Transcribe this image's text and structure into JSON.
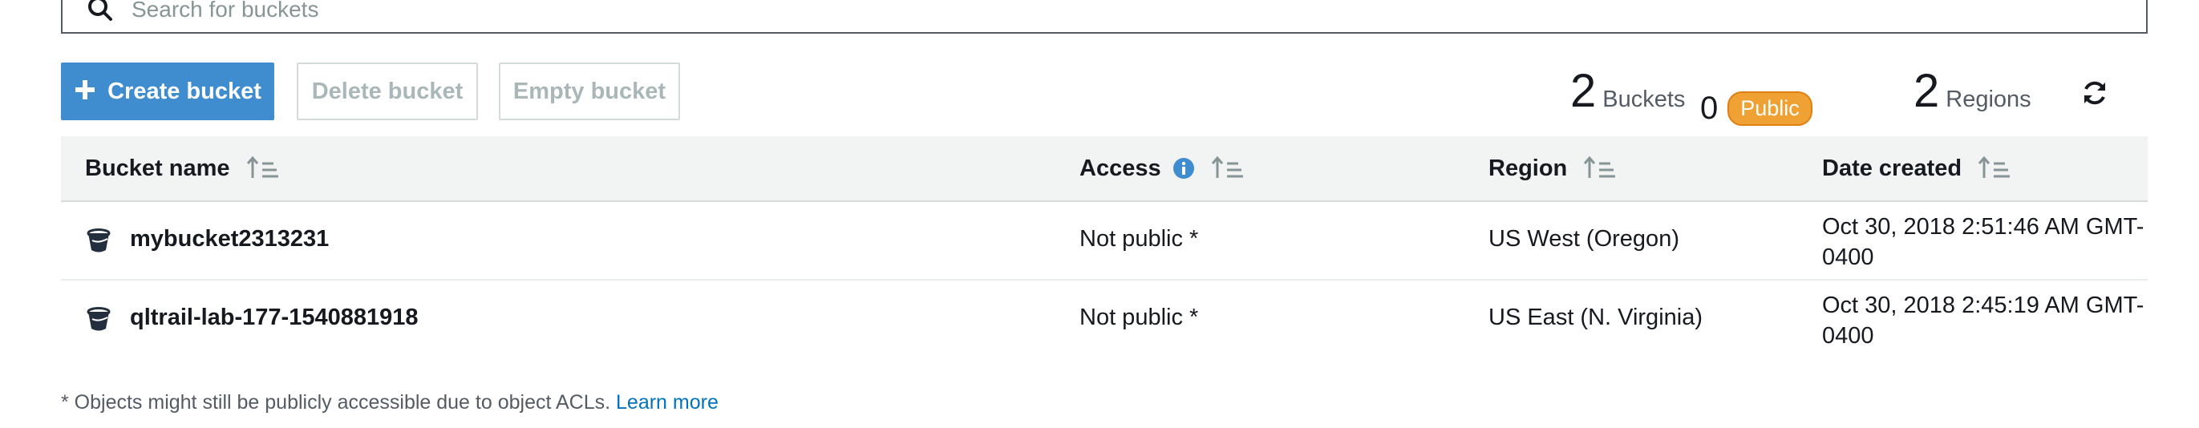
{
  "search": {
    "placeholder": "Search for buckets"
  },
  "toolbar": {
    "create_label": "Create bucket",
    "create_icon": "plus-icon",
    "delete_label": "Delete bucket",
    "empty_label": "Empty bucket"
  },
  "stats": {
    "bucket_count": "2",
    "bucket_label": "Buckets",
    "public_count": "0",
    "public_label": "Public",
    "region_count": "2",
    "region_label": "Regions",
    "refresh_icon": "refresh-icon"
  },
  "table": {
    "columns": [
      {
        "label": "Bucket name",
        "sort_icon": "sort-icon"
      },
      {
        "label": "Access",
        "info_icon": "info-icon",
        "sort_icon": "sort-icon"
      },
      {
        "label": "Region",
        "sort_icon": "sort-icon"
      },
      {
        "label": "Date created",
        "sort_icon": "sort-icon"
      }
    ],
    "rows": [
      {
        "icon": "bucket-icon",
        "name": "mybucket2313231",
        "access": "Not public *",
        "region": "US West (Oregon)",
        "date_line1": "Oct 30, 2018 2:51:46 AM GMT-",
        "date_line2": "0400"
      },
      {
        "icon": "bucket-icon",
        "name": "qltrail-lab-177-1540881918",
        "access": "Not public *",
        "region": "US East (N. Virginia)",
        "date_line1": "Oct 30, 2018 2:45:19 AM GMT-",
        "date_line2": "0400"
      }
    ]
  },
  "footnote": {
    "text": "* Objects might still be publicly accessible due to object ACLs. ",
    "link": "Learn more"
  },
  "colors": {
    "primary": "#3f8dcf",
    "public_badge": "#f0a133",
    "link": "#0073bb",
    "header_bg": "#f2f3f3"
  }
}
